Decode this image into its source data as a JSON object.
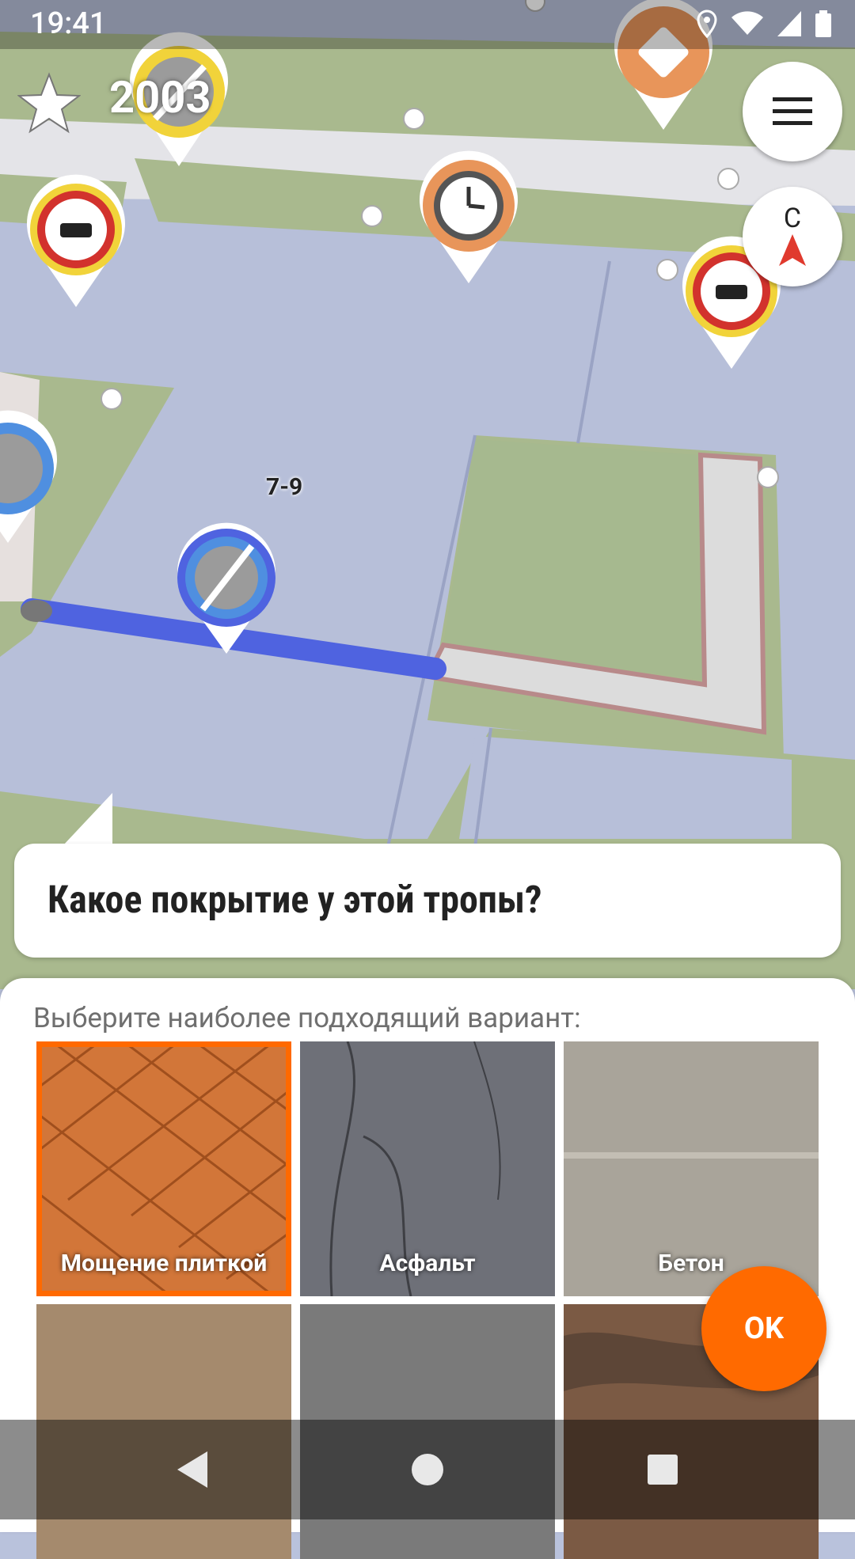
{
  "status_bar": {
    "time": "19:41"
  },
  "top_left": {
    "star_count": "2003"
  },
  "compass": {
    "letter": "С"
  },
  "map": {
    "house_number": "7-9"
  },
  "quest": {
    "question": "Какое покрытие у этой тропы?",
    "hint": "Выберите наиболее подходящий вариант:",
    "options": [
      {
        "label": "Мощение плиткой",
        "selected": true
      },
      {
        "label": "Асфальт",
        "selected": false
      },
      {
        "label": "Бетон",
        "selected": false
      }
    ],
    "ok_label": "OK"
  },
  "colors": {
    "accent": "#ff6a00",
    "route": "#4f63e0"
  }
}
